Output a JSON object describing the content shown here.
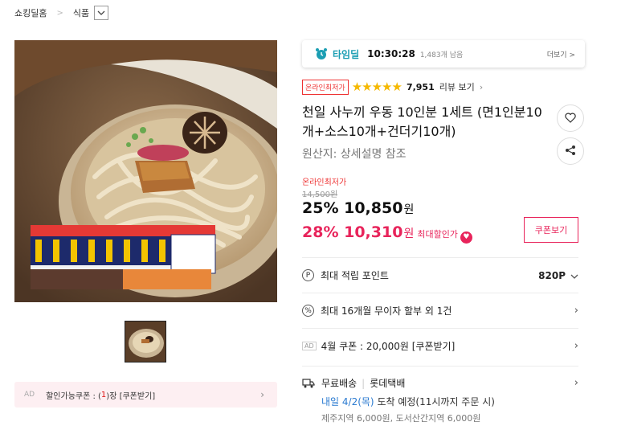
{
  "breadcrumb": {
    "home": "쇼킹딜홈",
    "category": "식품"
  },
  "gallery": {
    "coupon_ad": "AD",
    "coupon_text_prefix": "할인가능쿠폰 : (",
    "coupon_count": "1",
    "coupon_text_suffix": ")장 [쿠폰받기]"
  },
  "timedeal": {
    "label": "타임딜",
    "time": "10:30:28",
    "remaining": "1,483개 남음",
    "more": "더보기 >"
  },
  "rating": {
    "badge": "온라인최저가",
    "stars": "★★★★★",
    "count": "7,951",
    "review_link": "리뷰 보기"
  },
  "product": {
    "title": "천일 사누끼 우동 10인분 1세트 (면1인분10개+소스10개+건더기10개)",
    "origin": "원산지: 상세설명 참조"
  },
  "price": {
    "label": "온라인최저가",
    "original": "14,500원",
    "discount1_rate": "25%",
    "discount1_price": "10,850",
    "discount2_rate": "28%",
    "discount2_price": "10,310",
    "won": "원",
    "max_label": "최대할인가",
    "coupon_button": "쿠폰보기"
  },
  "benefits": {
    "points_label": "최대 적립 포인트",
    "points_value": "820P",
    "installment": "최대 16개월 무이자 할부 외 1건",
    "coupon_ad": "AD",
    "coupon_text": "4월 쿠폰 : 20,000원 [쿠폰받기]"
  },
  "shipping": {
    "free": "무료배송",
    "carrier": "롯데택배",
    "date": "내일 4/2(목)",
    "arrival": " 도착 예정(11시까지 주문 시)",
    "extra": "제주지역 6,000원, 도서산간지역 6,000원"
  },
  "colors": {
    "accent": "#e8245b",
    "teal": "#1b9eb3",
    "star": "#f5b800"
  }
}
